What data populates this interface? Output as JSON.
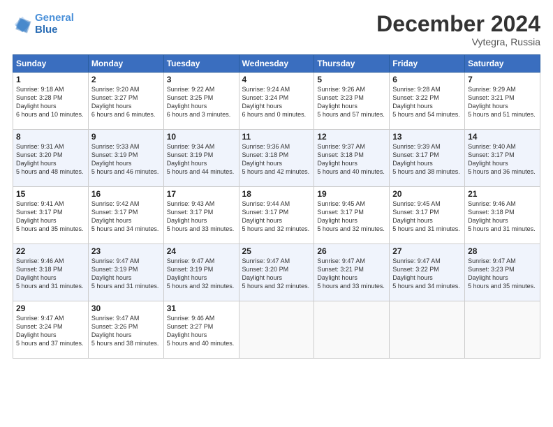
{
  "header": {
    "logo_line1": "General",
    "logo_line2": "Blue",
    "month": "December 2024",
    "location": "Vytegra, Russia"
  },
  "days_of_week": [
    "Sunday",
    "Monday",
    "Tuesday",
    "Wednesday",
    "Thursday",
    "Friday",
    "Saturday"
  ],
  "weeks": [
    [
      {
        "day": "1",
        "sunrise": "9:18 AM",
        "sunset": "3:28 PM",
        "daylight": "6 hours and 10 minutes."
      },
      {
        "day": "2",
        "sunrise": "9:20 AM",
        "sunset": "3:27 PM",
        "daylight": "6 hours and 6 minutes."
      },
      {
        "day": "3",
        "sunrise": "9:22 AM",
        "sunset": "3:25 PM",
        "daylight": "6 hours and 3 minutes."
      },
      {
        "day": "4",
        "sunrise": "9:24 AM",
        "sunset": "3:24 PM",
        "daylight": "6 hours and 0 minutes."
      },
      {
        "day": "5",
        "sunrise": "9:26 AM",
        "sunset": "3:23 PM",
        "daylight": "5 hours and 57 minutes."
      },
      {
        "day": "6",
        "sunrise": "9:28 AM",
        "sunset": "3:22 PM",
        "daylight": "5 hours and 54 minutes."
      },
      {
        "day": "7",
        "sunrise": "9:29 AM",
        "sunset": "3:21 PM",
        "daylight": "5 hours and 51 minutes."
      }
    ],
    [
      {
        "day": "8",
        "sunrise": "9:31 AM",
        "sunset": "3:20 PM",
        "daylight": "5 hours and 48 minutes."
      },
      {
        "day": "9",
        "sunrise": "9:33 AM",
        "sunset": "3:19 PM",
        "daylight": "5 hours and 46 minutes."
      },
      {
        "day": "10",
        "sunrise": "9:34 AM",
        "sunset": "3:19 PM",
        "daylight": "5 hours and 44 minutes."
      },
      {
        "day": "11",
        "sunrise": "9:36 AM",
        "sunset": "3:18 PM",
        "daylight": "5 hours and 42 minutes."
      },
      {
        "day": "12",
        "sunrise": "9:37 AM",
        "sunset": "3:18 PM",
        "daylight": "5 hours and 40 minutes."
      },
      {
        "day": "13",
        "sunrise": "9:39 AM",
        "sunset": "3:17 PM",
        "daylight": "5 hours and 38 minutes."
      },
      {
        "day": "14",
        "sunrise": "9:40 AM",
        "sunset": "3:17 PM",
        "daylight": "5 hours and 36 minutes."
      }
    ],
    [
      {
        "day": "15",
        "sunrise": "9:41 AM",
        "sunset": "3:17 PM",
        "daylight": "5 hours and 35 minutes."
      },
      {
        "day": "16",
        "sunrise": "9:42 AM",
        "sunset": "3:17 PM",
        "daylight": "5 hours and 34 minutes."
      },
      {
        "day": "17",
        "sunrise": "9:43 AM",
        "sunset": "3:17 PM",
        "daylight": "5 hours and 33 minutes."
      },
      {
        "day": "18",
        "sunrise": "9:44 AM",
        "sunset": "3:17 PM",
        "daylight": "5 hours and 32 minutes."
      },
      {
        "day": "19",
        "sunrise": "9:45 AM",
        "sunset": "3:17 PM",
        "daylight": "5 hours and 32 minutes."
      },
      {
        "day": "20",
        "sunrise": "9:45 AM",
        "sunset": "3:17 PM",
        "daylight": "5 hours and 31 minutes."
      },
      {
        "day": "21",
        "sunrise": "9:46 AM",
        "sunset": "3:18 PM",
        "daylight": "5 hours and 31 minutes."
      }
    ],
    [
      {
        "day": "22",
        "sunrise": "9:46 AM",
        "sunset": "3:18 PM",
        "daylight": "5 hours and 31 minutes."
      },
      {
        "day": "23",
        "sunrise": "9:47 AM",
        "sunset": "3:19 PM",
        "daylight": "5 hours and 31 minutes."
      },
      {
        "day": "24",
        "sunrise": "9:47 AM",
        "sunset": "3:19 PM",
        "daylight": "5 hours and 32 minutes."
      },
      {
        "day": "25",
        "sunrise": "9:47 AM",
        "sunset": "3:20 PM",
        "daylight": "5 hours and 32 minutes."
      },
      {
        "day": "26",
        "sunrise": "9:47 AM",
        "sunset": "3:21 PM",
        "daylight": "5 hours and 33 minutes."
      },
      {
        "day": "27",
        "sunrise": "9:47 AM",
        "sunset": "3:22 PM",
        "daylight": "5 hours and 34 minutes."
      },
      {
        "day": "28",
        "sunrise": "9:47 AM",
        "sunset": "3:23 PM",
        "daylight": "5 hours and 35 minutes."
      }
    ],
    [
      {
        "day": "29",
        "sunrise": "9:47 AM",
        "sunset": "3:24 PM",
        "daylight": "5 hours and 37 minutes."
      },
      {
        "day": "30",
        "sunrise": "9:47 AM",
        "sunset": "3:26 PM",
        "daylight": "5 hours and 38 minutes."
      },
      {
        "day": "31",
        "sunrise": "9:46 AM",
        "sunset": "3:27 PM",
        "daylight": "5 hours and 40 minutes."
      },
      null,
      null,
      null,
      null
    ]
  ]
}
